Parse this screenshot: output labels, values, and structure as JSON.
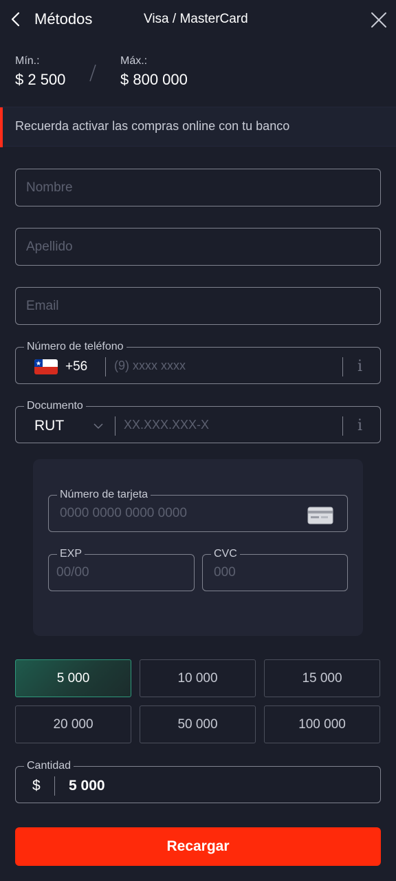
{
  "header": {
    "title": "Métodos",
    "subtitle": "Visa / MasterCard"
  },
  "limits": {
    "min_label": "Mín.:",
    "min_value": "$ 2 500",
    "separator": "/",
    "max_label": "Máx.:",
    "max_value": "$ 800 000"
  },
  "notice": {
    "text": "Recuerda activar las compras online con tu banco",
    "accent_color": "#ff2d1a"
  },
  "form": {
    "name_placeholder": "Nombre",
    "surname_placeholder": "Apellido",
    "email_placeholder": "Email",
    "phone": {
      "label": "Número de teléfono",
      "country_flag": "chile-flag",
      "code": "+56",
      "placeholder": "(9) xxxx xxxx",
      "info": "i"
    },
    "document": {
      "label": "Documento",
      "type": "RUT",
      "placeholder": "XX.XXX.XXX-X",
      "info": "i"
    }
  },
  "card": {
    "number_label": "Número de tarjeta",
    "number_placeholder": "0000 0000 0000 0000",
    "card_icon": "credit-card-icon",
    "exp_label": "EXP",
    "exp_placeholder": "00/00",
    "cvc_label": "CVC",
    "cvc_placeholder": "000"
  },
  "amounts": {
    "options": [
      "5 000",
      "10 000",
      "15 000",
      "20 000",
      "50 000",
      "100 000"
    ],
    "selected": "5 000"
  },
  "quantity": {
    "label": "Cantidad",
    "currency": "$",
    "value": "5 000"
  },
  "submit_label": "Recargar",
  "colors": {
    "background": "#1b1e2a",
    "primary": "#ff2a0a",
    "selected_amount": "#2f9a7c"
  }
}
